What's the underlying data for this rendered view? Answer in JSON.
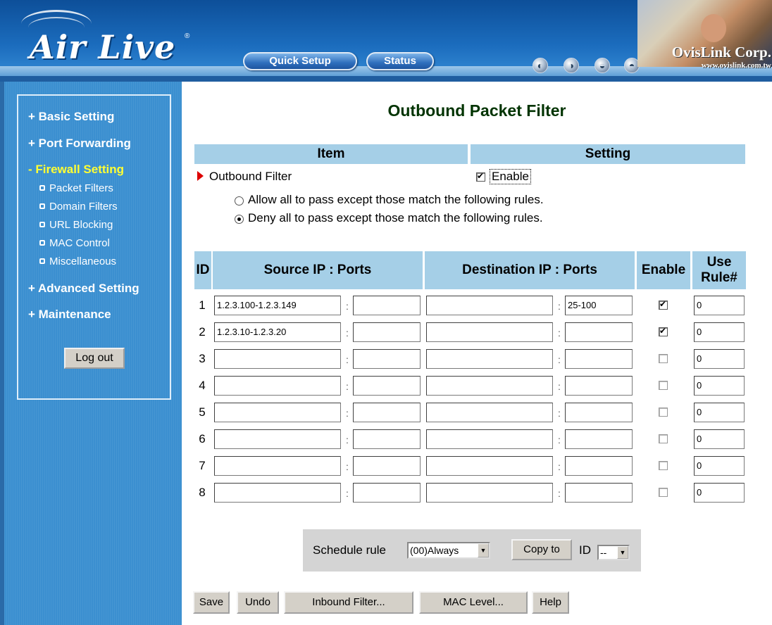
{
  "header": {
    "logo": "Air Live",
    "logo_mark": "®",
    "quick_setup": "Quick Setup",
    "status": "Status",
    "brand": "OvisLink Corp.",
    "brand_url": "www.ovislink.com.tw"
  },
  "sidebar": {
    "basic_setting": "+ Basic Setting",
    "port_forwarding": "+ Port Forwarding",
    "firewall_setting": "- Firewall Setting",
    "sub": [
      "Packet Filters",
      "Domain Filters",
      "URL Blocking",
      "MAC Control",
      "Miscellaneous"
    ],
    "advanced_setting": "+ Advanced Setting",
    "maintenance": "+ Maintenance",
    "logout": "Log out"
  },
  "page": {
    "title": "Outbound Packet Filter",
    "col_item": "Item",
    "col_setting": "Setting",
    "outbound_filter_label": "Outbound Filter",
    "enable_label": "Enable",
    "enable_checked": true,
    "allow_option": "Allow all to pass except those match the following rules.",
    "deny_option": "Deny all to pass except those match the following rules.",
    "selected_option": "deny"
  },
  "rules": {
    "headers": {
      "id": "ID",
      "source": "Source IP : Ports",
      "destination": "Destination IP : Ports",
      "enable": "Enable",
      "use_rule_1": "Use",
      "use_rule_2": "Rule#"
    },
    "rows": [
      {
        "id": "1",
        "src_ip": "1.2.3.100-1.2.3.149",
        "src_port": "",
        "dst_ip": "",
        "dst_port": "25-100",
        "enabled": true,
        "rule": "0"
      },
      {
        "id": "2",
        "src_ip": "1.2.3.10-1.2.3.20",
        "src_port": "",
        "dst_ip": "",
        "dst_port": "",
        "enabled": true,
        "rule": "0"
      },
      {
        "id": "3",
        "src_ip": "",
        "src_port": "",
        "dst_ip": "",
        "dst_port": "",
        "enabled": false,
        "rule": "0"
      },
      {
        "id": "4",
        "src_ip": "",
        "src_port": "",
        "dst_ip": "",
        "dst_port": "",
        "enabled": false,
        "rule": "0"
      },
      {
        "id": "5",
        "src_ip": "",
        "src_port": "",
        "dst_ip": "",
        "dst_port": "",
        "enabled": false,
        "rule": "0"
      },
      {
        "id": "6",
        "src_ip": "",
        "src_port": "",
        "dst_ip": "",
        "dst_port": "",
        "enabled": false,
        "rule": "0"
      },
      {
        "id": "7",
        "src_ip": "",
        "src_port": "",
        "dst_ip": "",
        "dst_port": "",
        "enabled": false,
        "rule": "0"
      },
      {
        "id": "8",
        "src_ip": "",
        "src_port": "",
        "dst_ip": "",
        "dst_port": "",
        "enabled": false,
        "rule": "0"
      }
    ]
  },
  "schedule": {
    "label": "Schedule rule",
    "rule_value": "(00)Always",
    "copy_to": "Copy to",
    "id_label": "ID",
    "id_value": "--"
  },
  "actions": {
    "save": "Save",
    "undo": "Undo",
    "inbound": "Inbound Filter...",
    "mac_level": "MAC Level...",
    "help": "Help"
  }
}
